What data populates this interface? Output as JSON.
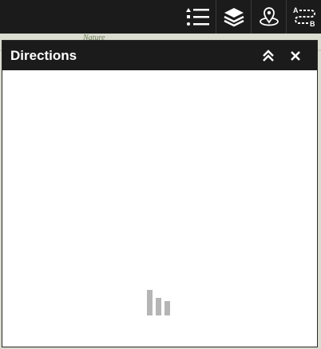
{
  "map": {
    "label": "Nature"
  },
  "toolbar": {
    "tools": [
      {
        "icon": "layer-list-icon"
      },
      {
        "icon": "layers-stack-icon"
      },
      {
        "icon": "map-pin-icon"
      },
      {
        "icon": "directions-ab-icon",
        "label_a": "A",
        "label_b": "B"
      }
    ]
  },
  "panel": {
    "title": "Directions",
    "collapse_icon": "double-chevron-up-icon",
    "close_icon": "close-icon",
    "loading": true
  },
  "colors": {
    "toolbar_bg": "#1b1b1b",
    "panel_bg": "#ffffff",
    "icon": "#ffffff",
    "loader": "#b5b5b5"
  }
}
